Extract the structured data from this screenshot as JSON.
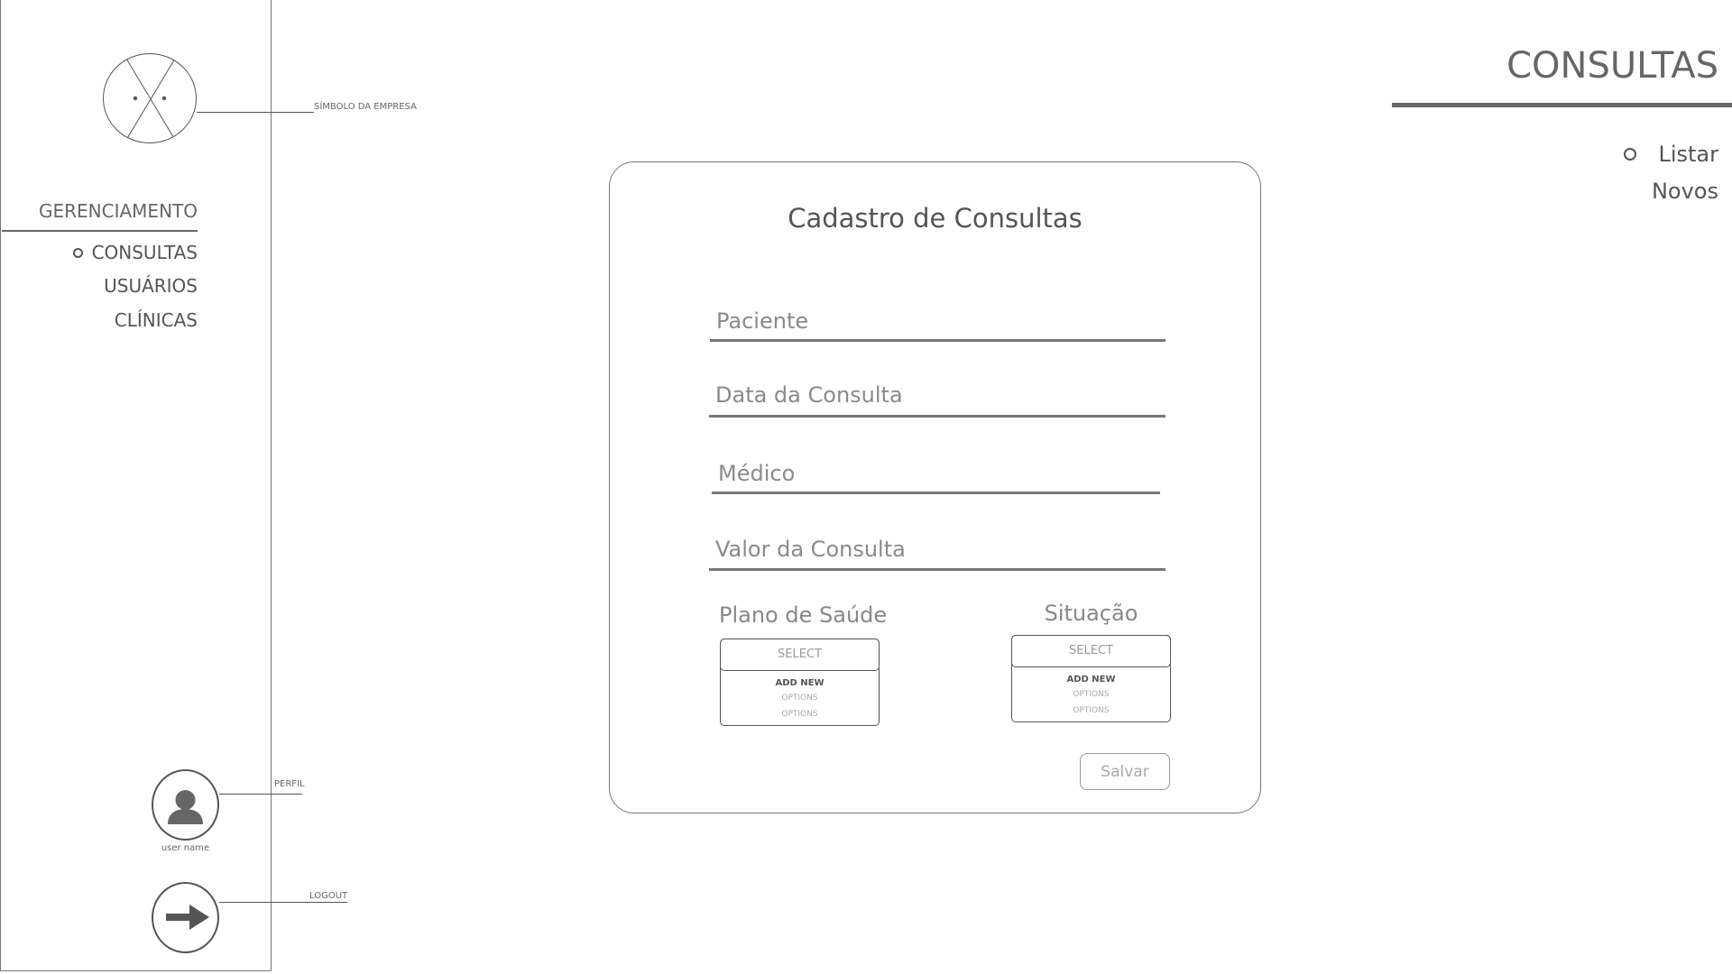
{
  "sidebar": {
    "logo_annotation": "SÍMBOLO DA EMPRESA",
    "section_heading": "GERENCIAMENTO",
    "nav_items": [
      {
        "label": "CONSULTAS",
        "active": true
      },
      {
        "label": "USUÁRIOS",
        "active": false
      },
      {
        "label": "CLÍNICAS",
        "active": false
      }
    ],
    "profile_annotation": "PERFIL",
    "user_name": "user name",
    "logout_annotation": "LOGOUT"
  },
  "header": {
    "title": "CONSULTAS",
    "sub_items": [
      {
        "label": "Listar",
        "active": true
      },
      {
        "label": "Novos",
        "active": false
      }
    ]
  },
  "form": {
    "title": "Cadastro de Consultas",
    "fields": {
      "paciente": {
        "placeholder": "Paciente",
        "value": ""
      },
      "data_consulta": {
        "placeholder": "Data da Consulta",
        "value": ""
      },
      "medico": {
        "placeholder": "Médico",
        "value": ""
      },
      "valor_consulta": {
        "placeholder": "Valor da Consulta",
        "value": ""
      }
    },
    "plano_saude": {
      "label": "Plano de Saúde",
      "select_label": "SELECT",
      "add_new": "ADD NEW",
      "options": [
        "OPTIONS",
        "OPTIONS"
      ]
    },
    "situacao": {
      "label": "Situação",
      "select_label": "SELECT",
      "add_new": "ADD NEW",
      "options": [
        "OPTIONS",
        "OPTIONS"
      ]
    },
    "save_label": "Salvar"
  },
  "colors": {
    "stroke": "#555555",
    "text": "#555555",
    "muted_text": "#999999"
  },
  "icons": {
    "logo": "x-circle-logo-icon",
    "profile": "user-avatar-icon",
    "logout": "arrow-right-icon",
    "bullet": "circle-bullet-icon"
  }
}
